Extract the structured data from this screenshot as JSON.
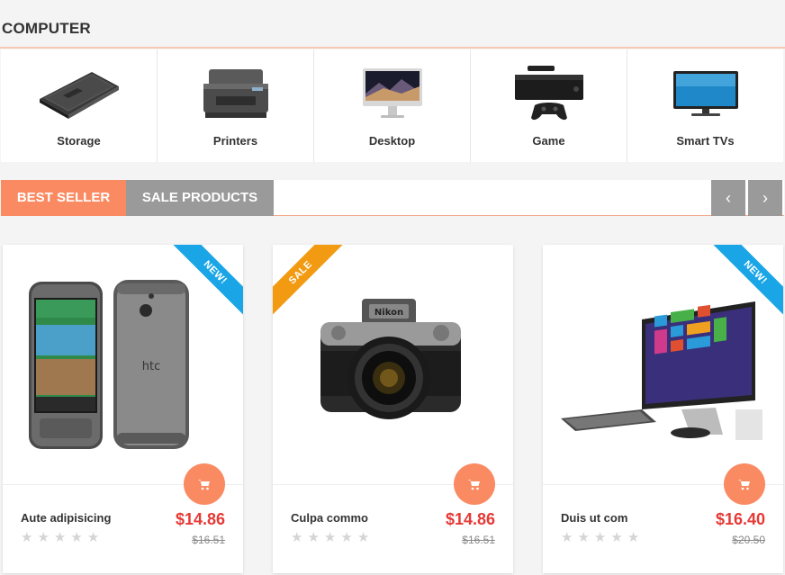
{
  "section": {
    "title": "COMPUTER"
  },
  "categories": [
    {
      "label": "Storage",
      "icon": "hard-drive-icon"
    },
    {
      "label": "Printers",
      "icon": "printer-icon"
    },
    {
      "label": "Desktop",
      "icon": "imac-icon"
    },
    {
      "label": "Game",
      "icon": "game-console-icon"
    },
    {
      "label": "Smart TVs",
      "icon": "tv-icon"
    }
  ],
  "tabs": {
    "best_seller": "BEST SELLER",
    "sale_products": "SALE PRODUCTS"
  },
  "carousel": {
    "prev": "‹",
    "next": "›"
  },
  "products": [
    {
      "name": "Aute adipisicing",
      "price": "$14.86",
      "old_price": "$16.51",
      "badge": "NEW!",
      "badge_type": "new",
      "rating": 0,
      "image": "smartphone-image"
    },
    {
      "name": "Culpa commo",
      "price": "$14.86",
      "old_price": "$16.51",
      "badge": "SALE",
      "badge_type": "sale",
      "rating": 0,
      "image": "camera-image"
    },
    {
      "name": "Duis ut com",
      "price": "$16.40",
      "old_price": "$20.50",
      "badge": "NEW!",
      "badge_type": "new",
      "rating": 0,
      "image": "all-in-one-pc-image"
    }
  ],
  "colors": {
    "accent": "#fa8a62",
    "tab_inactive": "#9a9a9a",
    "price": "#e53935",
    "badge_new": "#1aa6e6",
    "badge_sale": "#f29a12"
  }
}
